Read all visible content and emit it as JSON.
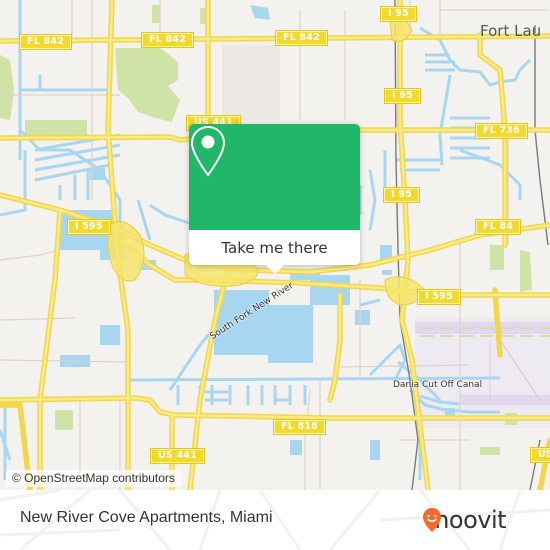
{
  "map": {
    "city_label": "Fort Lau",
    "river_labels": {
      "south_fork": "South Fork New River",
      "dania_canal": "Dania Cut Off Canal"
    },
    "shields": {
      "fl842_a": "FL 842",
      "fl842_b": "FL 842",
      "fl842_c": "FL 842",
      "i95_top": "I 95",
      "i95_mid": "I 95",
      "i95_lower": "I 95",
      "us441_top": "US 441",
      "fl736": "FL 736",
      "i595_west": "I 595",
      "fl84": "FL 84",
      "i595_east": "I 595",
      "fl818": "FL 818",
      "us441_bottom": "US 441",
      "us1_partial": "US"
    },
    "colors": {
      "land": "#f3f2ee",
      "water": "#a8d6f0",
      "park": "#cfe3a6",
      "road_major": "#f6e46a",
      "road_minor": "#d8d4cc",
      "airport": "#e4dcef",
      "rail": "#777777"
    }
  },
  "popup": {
    "button_label": "Take me there",
    "icon": "map-pin-icon",
    "color": "#20b868"
  },
  "attribution": "© OpenStreetMap contributors",
  "footer": {
    "place_name": "New River Cove Apartments, Miami",
    "logo_text": "moovit",
    "logo_icon": "moovit-smile-pin-icon",
    "logo_color": "#f26b2f"
  }
}
